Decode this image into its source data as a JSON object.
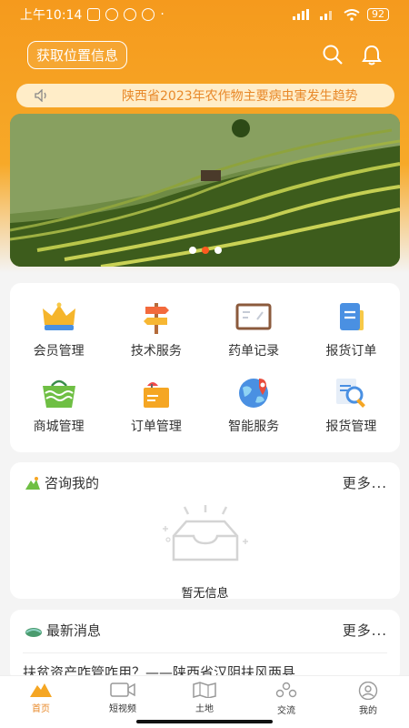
{
  "status_bar": {
    "time": "上午10:14",
    "battery": "92"
  },
  "header": {
    "location_button": "获取位置信息"
  },
  "notice": {
    "text": "陕西省2023年农作物主要病虫害发生趋势"
  },
  "banner": {
    "dots": 3,
    "active_index": 1
  },
  "grid": {
    "items": [
      {
        "label": "会员管理",
        "icon": "crown-icon"
      },
      {
        "label": "技术服务",
        "icon": "signpost-icon"
      },
      {
        "label": "药单记录",
        "icon": "board-icon"
      },
      {
        "label": "报货订单",
        "icon": "document-icon"
      },
      {
        "label": "商城管理",
        "icon": "basket-icon"
      },
      {
        "label": "订单管理",
        "icon": "package-icon"
      },
      {
        "label": "智能服务",
        "icon": "globe-icon"
      },
      {
        "label": "报货管理",
        "icon": "magnifier-doc-icon"
      }
    ]
  },
  "consult": {
    "title": "咨询我的",
    "more": "更多...",
    "empty": "暂无信息"
  },
  "news": {
    "title": "最新消息",
    "more": "更多...",
    "first_item": "扶贫资产咋管咋用？——陕西省汉阴扶风两县..."
  },
  "bottom_nav": [
    {
      "label": "首页",
      "icon": "home-mountain-icon"
    },
    {
      "label": "短视频",
      "icon": "video-icon"
    },
    {
      "label": "土地",
      "icon": "map-icon"
    },
    {
      "label": "交流",
      "icon": "people-icon"
    },
    {
      "label": "我的",
      "icon": "user-icon"
    }
  ],
  "colors": {
    "accent": "#f59a1d",
    "notice_text": "#e8892a"
  }
}
